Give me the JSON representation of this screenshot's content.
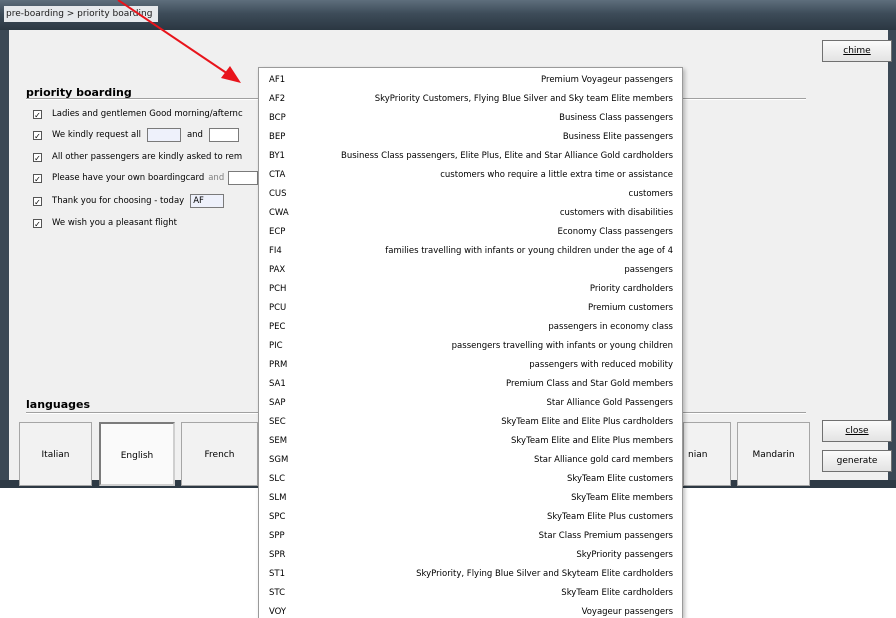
{
  "window": {
    "title": "pre-boarding > priority boarding"
  },
  "buttons": {
    "chime": "chime",
    "close": "close",
    "generate": "generate"
  },
  "priority": {
    "heading": "priority boarding",
    "rows": [
      {
        "text": "Ladies and gentlemen Good morning/afternc",
        "checked": true
      },
      {
        "text": "We kindly request all",
        "and": "and",
        "checked": true
      },
      {
        "text": "All other passengers are kindly asked to rem",
        "checked": true
      },
      {
        "text": "Please have your own boardingcard",
        "suffix": "and",
        "checked": true
      },
      {
        "text": "Thank you for choosing - today",
        "value": "AF",
        "checked": true
      },
      {
        "text": "We wish you a pleasant flight",
        "checked": true
      }
    ]
  },
  "languages": {
    "heading": "languages",
    "items": [
      "Italian",
      "English",
      "French",
      "nian",
      "Mandarin"
    ]
  },
  "dropdown": {
    "items": [
      {
        "code": "AF1",
        "desc": "Premium Voyageur passengers"
      },
      {
        "code": "AF2",
        "desc": "SkyPriority Customers, Flying Blue Silver and Sky team Elite members"
      },
      {
        "code": "BCP",
        "desc": "Business Class passengers"
      },
      {
        "code": "BEP",
        "desc": "Business Elite passengers"
      },
      {
        "code": "BY1",
        "desc": "Business Class passengers, Elite Plus, Elite and Star Alliance Gold cardholders"
      },
      {
        "code": "CTA",
        "desc": "customers who require a little extra time or assistance"
      },
      {
        "code": "CUS",
        "desc": "customers"
      },
      {
        "code": "CWA",
        "desc": "customers with disabilities"
      },
      {
        "code": "ECP",
        "desc": "Economy Class passengers"
      },
      {
        "code": "FI4",
        "desc": "families travelling with infants or young children under the age of 4"
      },
      {
        "code": "PAX",
        "desc": "passengers"
      },
      {
        "code": "PCH",
        "desc": "Priority cardholders"
      },
      {
        "code": "PCU",
        "desc": "Premium customers"
      },
      {
        "code": "PEC",
        "desc": "passengers in economy class"
      },
      {
        "code": "PIC",
        "desc": "passengers travelling with infants or young children"
      },
      {
        "code": "PRM",
        "desc": "passengers with reduced mobility"
      },
      {
        "code": "SA1",
        "desc": "Premium Class and Star Gold members"
      },
      {
        "code": "SAP",
        "desc": "Star Alliance Gold Passengers"
      },
      {
        "code": "SEC",
        "desc": "SkyTeam Elite and Elite Plus cardholders"
      },
      {
        "code": "SEM",
        "desc": "SkyTeam Elite and Elite Plus members"
      },
      {
        "code": "SGM",
        "desc": "Star Alliance gold card members"
      },
      {
        "code": "SLC",
        "desc": "SkyTeam Elite customers"
      },
      {
        "code": "SLM",
        "desc": "SkyTeam Elite members"
      },
      {
        "code": "SPC",
        "desc": "SkyTeam Elite Plus customers"
      },
      {
        "code": "SPP",
        "desc": "Star Class Premium passengers"
      },
      {
        "code": "SPR",
        "desc": "SkyPriority passengers"
      },
      {
        "code": "ST1",
        "desc": "SkyPriority, Flying Blue Silver and Skyteam Elite cardholders"
      },
      {
        "code": "STC",
        "desc": "SkyTeam Elite cardholders"
      },
      {
        "code": "VOY",
        "desc": "Voyageur passengers"
      }
    ]
  },
  "annotation": {
    "arrow_color": "#e8141b"
  }
}
